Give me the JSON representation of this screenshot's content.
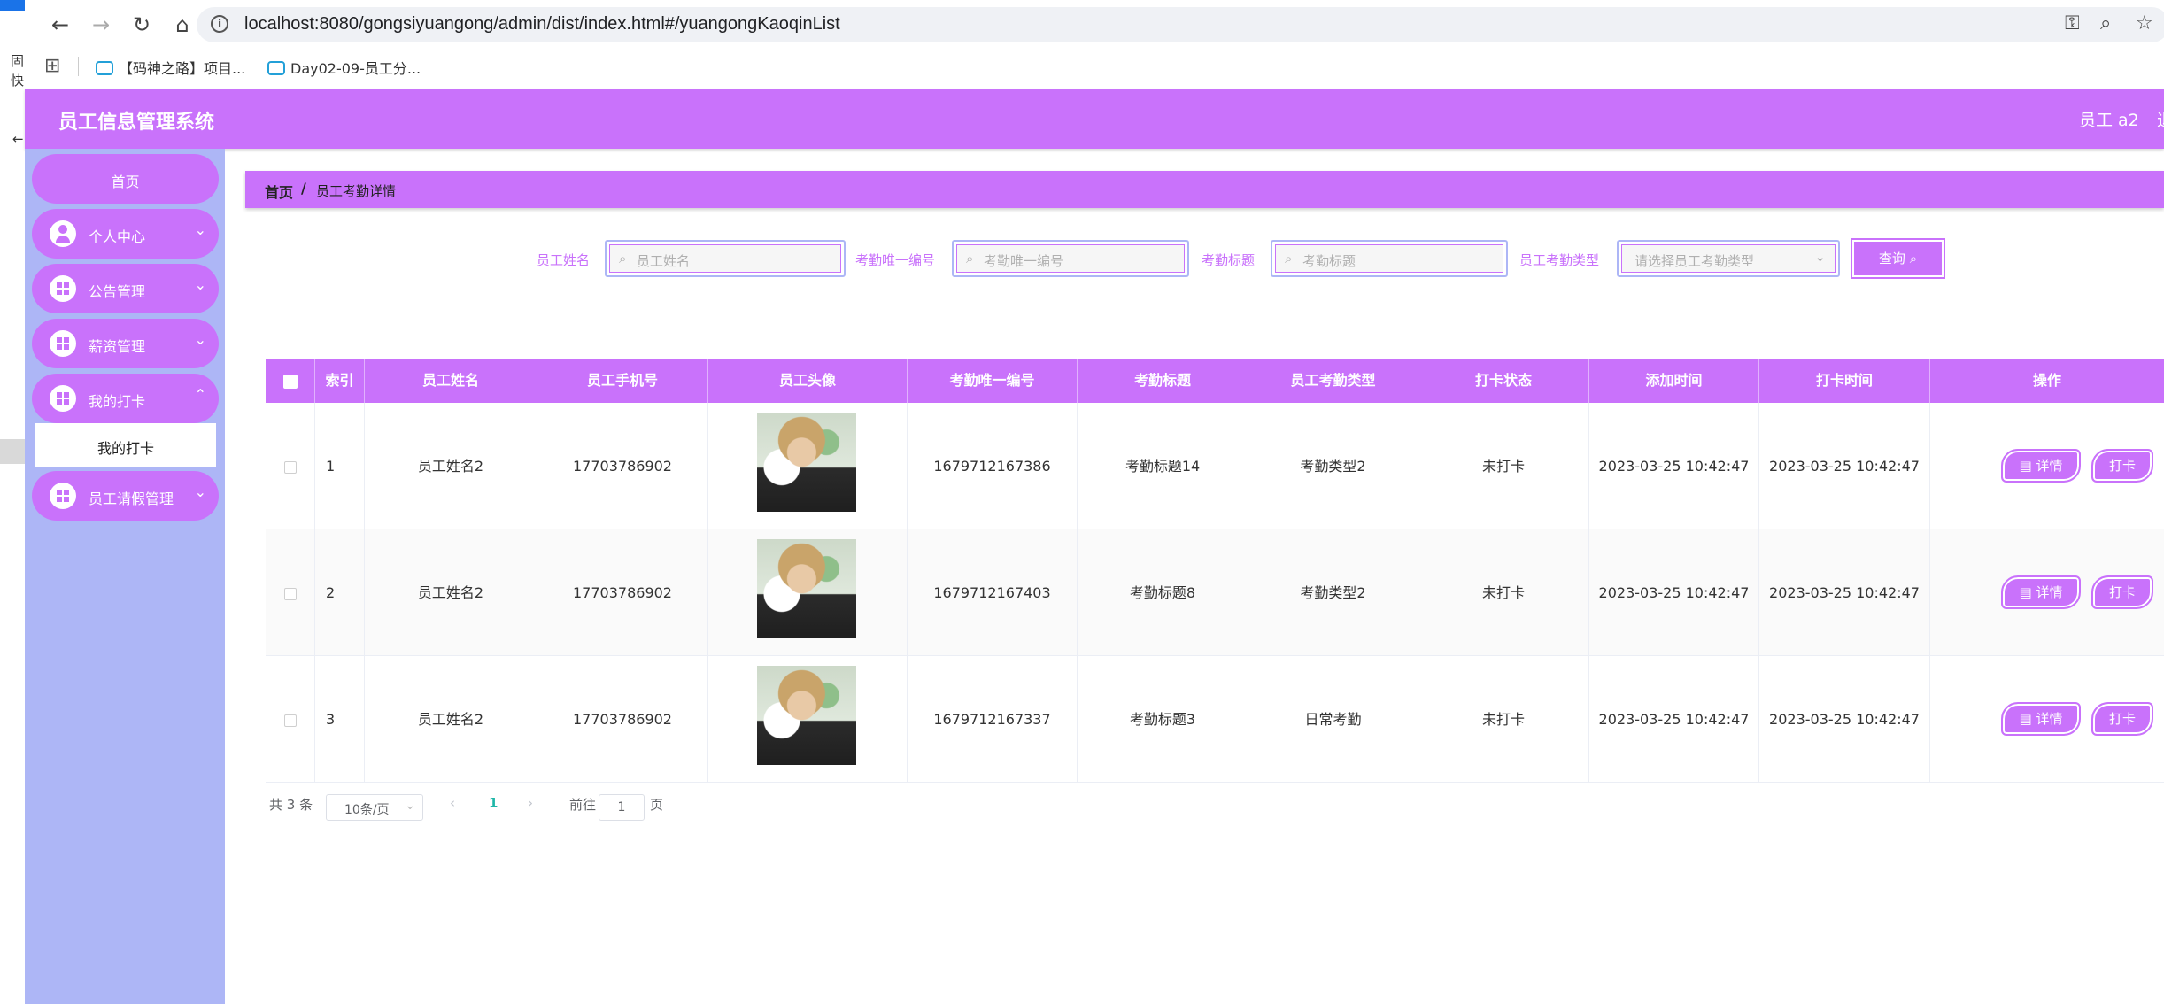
{
  "browser": {
    "url": "localhost:8080/gongsiyuangong/admin/dist/index.html#/yuangongKaoqinList",
    "bookmarks": [
      "【码神之路】项目...",
      "Day02-09-员工分..."
    ],
    "left_window_chars": [
      "固",
      "快",
      "←"
    ]
  },
  "app": {
    "title": "员工信息管理系统",
    "user": "员工 a2",
    "user_suffix": "退"
  },
  "sidebar": {
    "items": [
      {
        "label": "首页",
        "icon": "none"
      },
      {
        "label": "个人中心",
        "icon": "person-icon"
      },
      {
        "label": "公告管理",
        "icon": "grid-icon"
      },
      {
        "label": "薪资管理",
        "icon": "grid-icon"
      },
      {
        "label": "我的打卡",
        "icon": "grid-icon"
      },
      {
        "label": "员工请假管理",
        "icon": "grid-icon"
      }
    ],
    "submenu_item": "我的打卡"
  },
  "breadcrumb": {
    "home": "首页",
    "separator": "/",
    "current": "员工考勤详情"
  },
  "search": {
    "fields": [
      {
        "label": "员工姓名",
        "placeholder": "员工姓名"
      },
      {
        "label": "考勤唯一编号",
        "placeholder": "考勤唯一编号"
      },
      {
        "label": "考勤标题",
        "placeholder": "考勤标题"
      },
      {
        "label": "员工考勤类型",
        "placeholder": "请选择员工考勤类型"
      }
    ],
    "button_label": "查询"
  },
  "table": {
    "headers": [
      "",
      "索引",
      "员工姓名",
      "员工手机号",
      "员工头像",
      "考勤唯一编号",
      "考勤标题",
      "员工考勤类型",
      "打卡状态",
      "添加时间",
      "打卡时间",
      "操作"
    ],
    "rows": [
      {
        "index": "1",
        "name": "员工姓名2",
        "phone": "17703786902",
        "code": "1679712167386",
        "title": "考勤标题14",
        "type": "考勤类型2",
        "status": "未打卡",
        "added": "2023-03-25 10:42:47",
        "punched": "2023-03-25 10:42:47"
      },
      {
        "index": "2",
        "name": "员工姓名2",
        "phone": "17703786902",
        "code": "1679712167403",
        "title": "考勤标题8",
        "type": "考勤类型2",
        "status": "未打卡",
        "added": "2023-03-25 10:42:47",
        "punched": "2023-03-25 10:42:47"
      },
      {
        "index": "3",
        "name": "员工姓名2",
        "phone": "17703786902",
        "code": "1679712167337",
        "title": "考勤标题3",
        "type": "日常考勤",
        "status": "未打卡",
        "added": "2023-03-25 10:42:47",
        "punched": "2023-03-25 10:42:47"
      }
    ],
    "actions": {
      "detail": "详情",
      "punch": "打卡"
    }
  },
  "pagination": {
    "total": "共 3 条",
    "page_size": "10条/页",
    "current_page": "1",
    "goto_prefix": "前往",
    "goto_value": "1",
    "goto_suffix": "页"
  },
  "colors": {
    "accent": "#c972fb",
    "sidebar_bg": "#adb6f6",
    "input_border": "#adb6f6"
  }
}
